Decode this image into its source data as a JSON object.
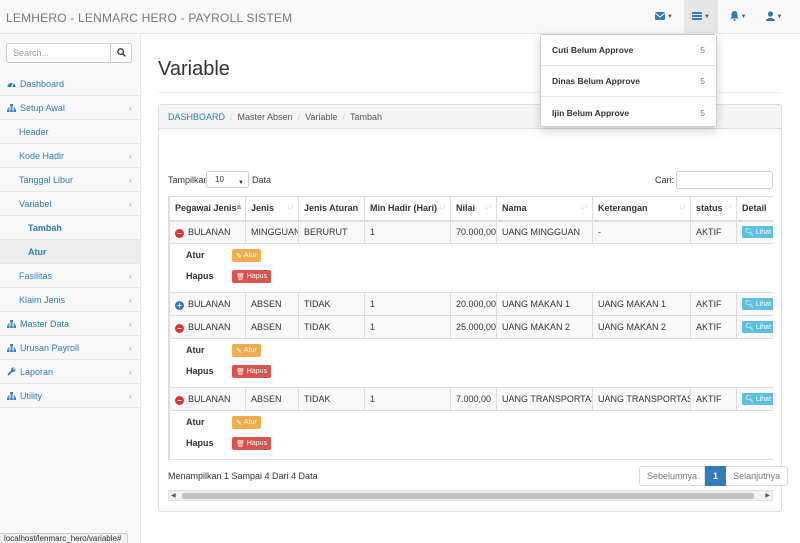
{
  "navbar": {
    "brand": "LEMHERO - LENMARC HERO - PAYROLL SISTEM",
    "icons": [
      "envelope-icon",
      "tasks-icon",
      "bell-icon",
      "user-icon"
    ]
  },
  "search": {
    "placeholder": "Search..."
  },
  "sidebar": {
    "items": [
      {
        "label": "Dashboard",
        "icon": "dashboard-icon",
        "level": 1
      },
      {
        "label": "Setup Awal",
        "icon": "sitemap-icon",
        "level": 1
      },
      {
        "label": "Header",
        "level": 2
      },
      {
        "label": "Kode Hadir",
        "level": 2
      },
      {
        "label": "Tanggal Libur",
        "level": 2
      },
      {
        "label": "Variabel",
        "level": 2
      },
      {
        "label": "Tambah",
        "level": 3
      },
      {
        "label": "Atur",
        "level": 3
      },
      {
        "label": "Fasilitas",
        "level": 2
      },
      {
        "label": "Klaim Jenis",
        "level": 2
      },
      {
        "label": "Master Data",
        "icon": "sitemap-icon",
        "level": 1
      },
      {
        "label": "Urusan Payroll",
        "icon": "sitemap-icon",
        "level": 1
      },
      {
        "label": "Laporan",
        "icon": "wrench-icon",
        "level": 1
      },
      {
        "label": "Utility",
        "icon": "sitemap-icon",
        "level": 1
      }
    ]
  },
  "page": {
    "title": "Variable",
    "breadcrumb": [
      "DASHBOARD",
      "Master Absen",
      "Variable",
      "Tambah"
    ]
  },
  "table_controls": {
    "show_label": "Tampilkan",
    "page_length": "10",
    "show_after": "Data",
    "search_label": "Cari:"
  },
  "table": {
    "headers": [
      "Pegawai Jenis",
      "Jenis",
      "Jenis Aturan",
      "Min Hadir (Hari)",
      "Nilai",
      "Nama",
      "Keterangan",
      "status",
      "Detail"
    ],
    "rows": [
      {
        "pegawai_jenis": "BULANAN",
        "jenis": "MINGGUAN",
        "jenis_aturan": "BERURUT",
        "min_hadir": "1",
        "nilai": "70.000,00",
        "nama": "UANG MINGGUAN",
        "keterangan": "-",
        "status": "AKTIF",
        "detail": "Lihat"
      },
      {
        "pegawai_jenis": "BULANAN",
        "jenis": "ABSEN",
        "jenis_aturan": "TIDAK",
        "min_hadir": "1",
        "nilai": "20.000,00",
        "nama": "UANG MAKAN 1",
        "keterangan": "UANG MAKAN 1",
        "status": "AKTIF",
        "detail": "Lihat"
      },
      {
        "pegawai_jenis": "BULANAN",
        "jenis": "ABSEN",
        "jenis_aturan": "TIDAK",
        "min_hadir": "1",
        "nilai": "25.000,00",
        "nama": "UANG MAKAN 2",
        "keterangan": "UANG MAKAN 2",
        "status": "AKTIF",
        "detail": "Lihat"
      },
      {
        "pegawai_jenis": "BULANAN",
        "jenis": "ABSEN",
        "jenis_aturan": "TIDAK",
        "min_hadir": "1",
        "nilai": "7.000,00",
        "nama": "UANG TRANSPORTASI",
        "keterangan": "UANG TRANSPORTASI",
        "status": "AKTIF",
        "detail": "Lihat"
      }
    ],
    "child": {
      "atur_label": "Atur",
      "atur_button": "Atur",
      "hapus_label": "Hapus",
      "hapus_button": "Hapus"
    }
  },
  "footer": {
    "info": "Menampilkan 1 Sampai 4 Dari 4 Data",
    "prev": "Sebelumnya",
    "current": "1",
    "next": "Selanjutnya"
  },
  "dropdown": {
    "items": [
      {
        "label": "Cuti Belum Approve",
        "count": "5"
      },
      {
        "label": "Dinas Belum Approve",
        "count": "5"
      },
      {
        "label": "Ijin Belum Approve",
        "count": "5"
      }
    ]
  },
  "statusbar": {
    "url": "localhost/lenmarc_hero/variable#"
  },
  "colors": {
    "link": "#337ab7",
    "warning": "#f0ad4e",
    "danger": "#d9534f",
    "info": "#5bc0de"
  }
}
